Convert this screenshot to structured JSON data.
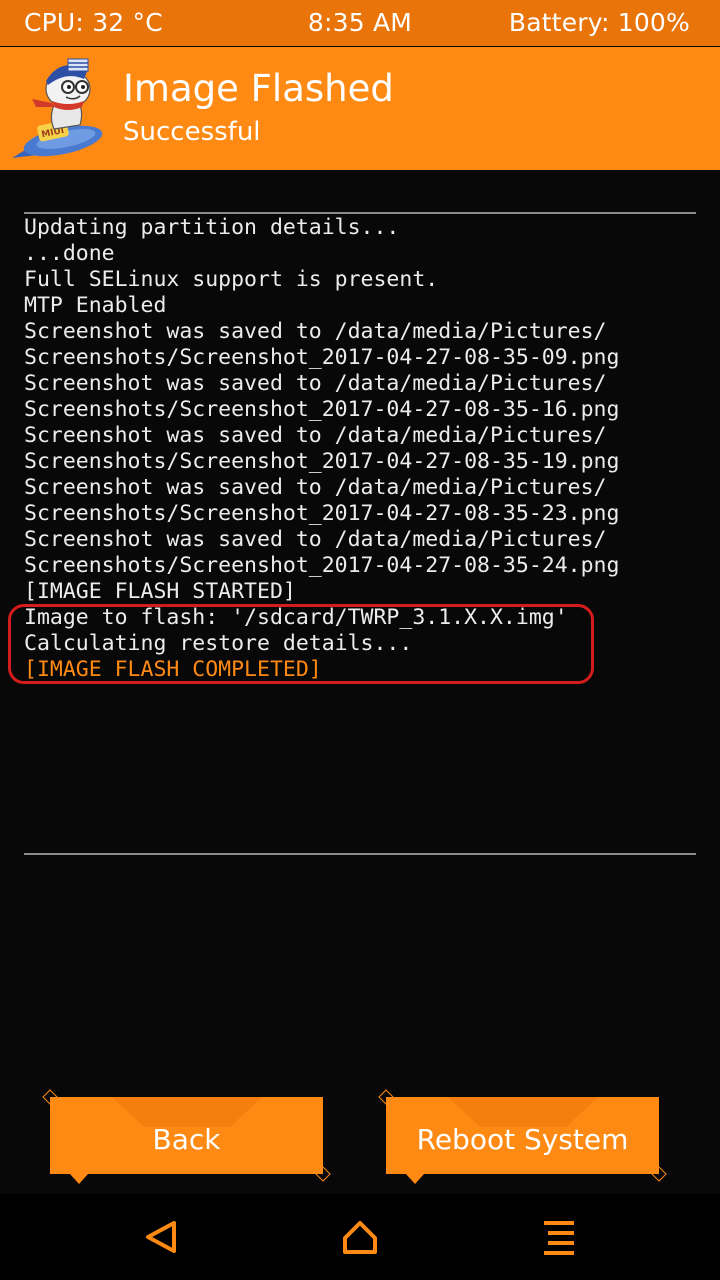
{
  "status_bar": {
    "cpu": "CPU: 32 °C",
    "time": "8:35 AM",
    "battery": "Battery: 100%"
  },
  "header": {
    "title": "Image Flashed",
    "subtitle": "Successful",
    "logo_icon": "miui-mascot-logo"
  },
  "console": {
    "lines": [
      "Updating partition details...",
      "...done",
      "Full SELinux support is present.",
      "MTP Enabled",
      "Screenshot was saved to /data/media/Pictures/",
      "Screenshots/Screenshot_2017-04-27-08-35-09.png",
      "Screenshot was saved to /data/media/Pictures/",
      "Screenshots/Screenshot_2017-04-27-08-35-16.png",
      "Screenshot was saved to /data/media/Pictures/",
      "Screenshots/Screenshot_2017-04-27-08-35-19.png",
      "Screenshot was saved to /data/media/Pictures/",
      "Screenshots/Screenshot_2017-04-27-08-35-23.png",
      "Screenshot was saved to /data/media/Pictures/",
      "Screenshots/Screenshot_2017-04-27-08-35-24.png",
      "[IMAGE FLASH STARTED]",
      "Image to flash: '/sdcard/TWRP_3.1.X.X.img'",
      "Calculating restore details...",
      "[IMAGE FLASH COMPLETED]"
    ],
    "highlight_color": "#ff8a13"
  },
  "buttons": {
    "back": "Back",
    "reboot": "Reboot System"
  },
  "nav": {
    "back_icon": "triangle-back-icon",
    "home_icon": "home-icon",
    "menu_icon": "menu-icon"
  },
  "colors": {
    "accent": "#ff8a13",
    "status_bar": "#e8740a",
    "background": "#080808",
    "annotation": "#d51c1c"
  }
}
